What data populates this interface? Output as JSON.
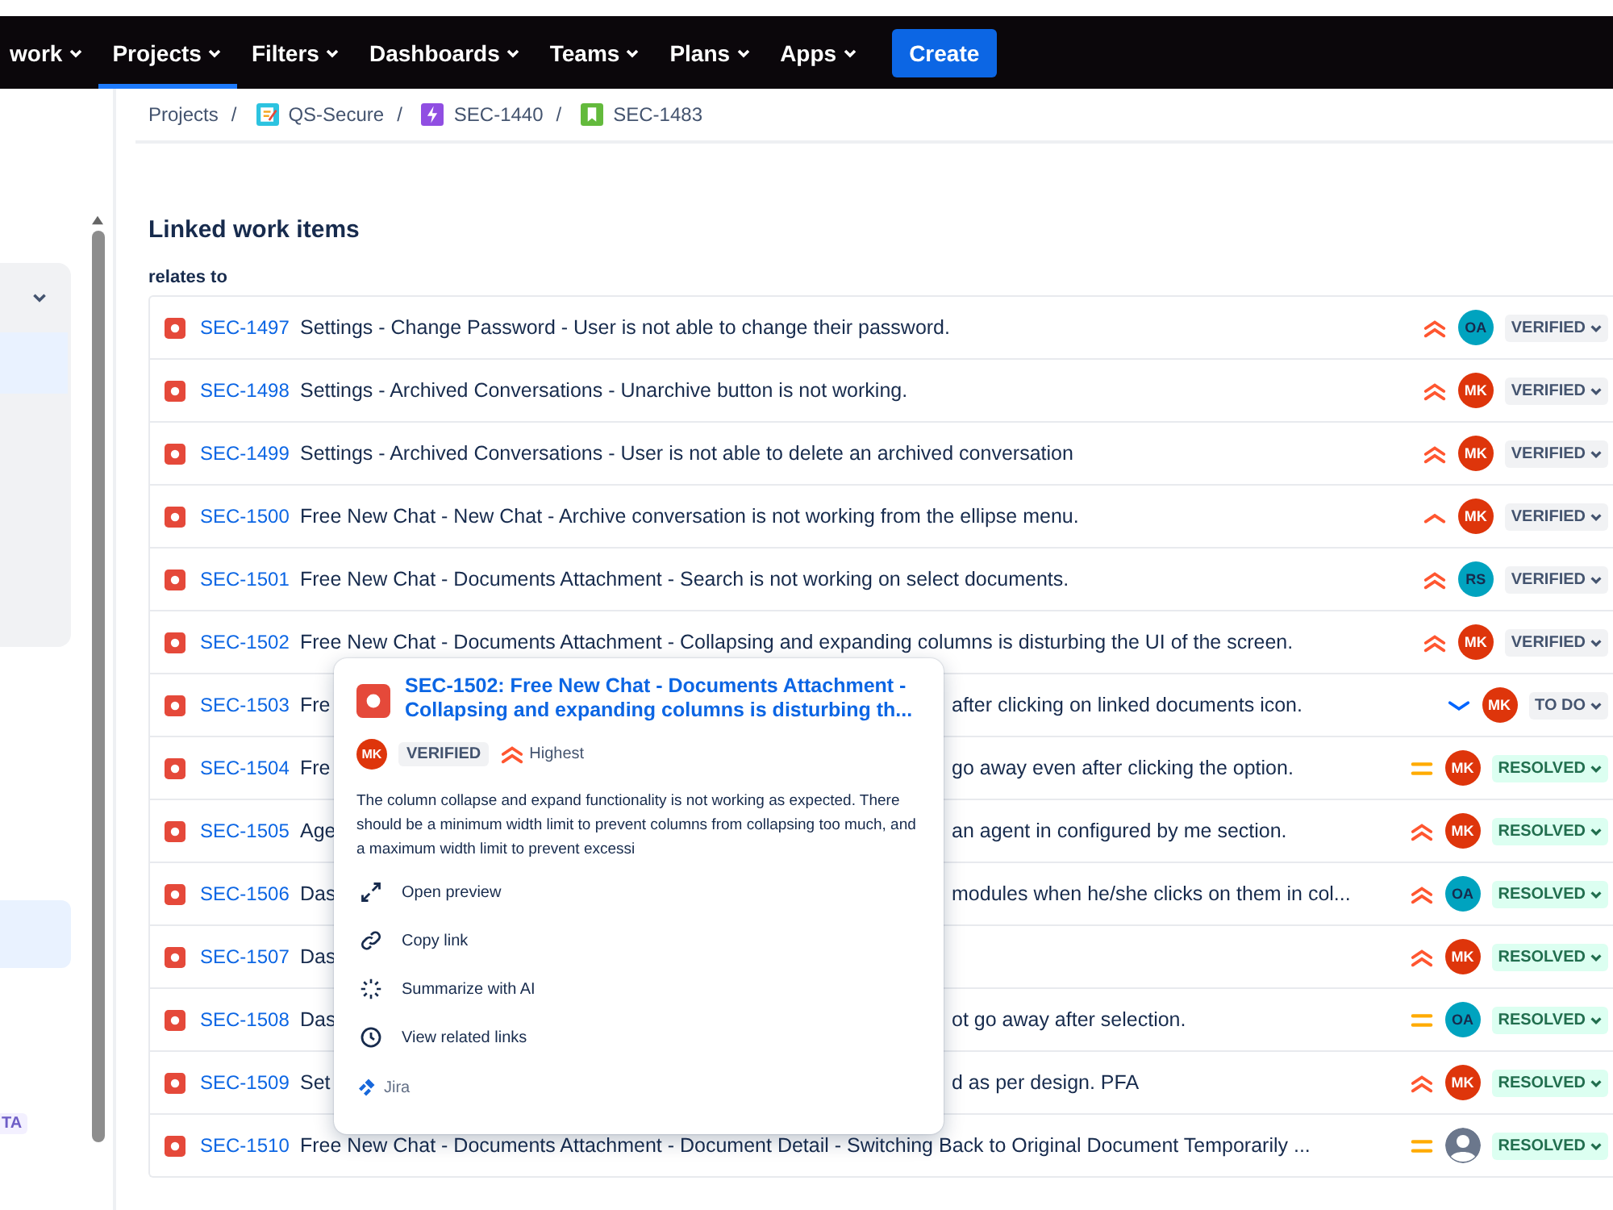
{
  "nav": {
    "items": [
      {
        "label": "work",
        "selected": false
      },
      {
        "label": "Projects",
        "selected": true
      },
      {
        "label": "Filters",
        "selected": false
      },
      {
        "label": "Dashboards",
        "selected": false
      },
      {
        "label": "Teams",
        "selected": false
      },
      {
        "label": "Plans",
        "selected": false
      },
      {
        "label": "Apps",
        "selected": false
      }
    ],
    "create": "Create"
  },
  "sidebar": {
    "badge": "TA"
  },
  "breadcrumbs": [
    {
      "label": "Projects",
      "kind": "text"
    },
    {
      "separator": "/",
      "label": "QS-Secure",
      "kind": "project"
    },
    {
      "separator": "/",
      "label": "SEC-1440",
      "kind": "epic"
    },
    {
      "separator": "/",
      "label": "SEC-1483",
      "kind": "story"
    }
  ],
  "section": {
    "title": "Linked work items",
    "relation": "relates to"
  },
  "rows": [
    {
      "key": "SEC-1497",
      "summary": "Settings - Change Password - User is not able to change their password.",
      "priority": {
        "kind": "highest"
      },
      "assignee": {
        "initials": "OA",
        "color": "#00a3bf"
      },
      "status": {
        "label": "VERIFIED",
        "kind": "verified"
      }
    },
    {
      "key": "SEC-1498",
      "summary": "Settings - Archived Conversations - Unarchive button is not working.",
      "priority": {
        "kind": "highest"
      },
      "assignee": {
        "initials": "MK",
        "color": "#de350b"
      },
      "status": {
        "label": "VERIFIED",
        "kind": "verified"
      }
    },
    {
      "key": "SEC-1499",
      "summary": "Settings - Archived Conversations - User is not able to delete an archived conversation",
      "priority": {
        "kind": "highest"
      },
      "assignee": {
        "initials": "MK",
        "color": "#de350b"
      },
      "status": {
        "label": "VERIFIED",
        "kind": "verified"
      }
    },
    {
      "key": "SEC-1500",
      "summary": "Free New Chat - New Chat - Archive conversation is not working from the ellipse menu.",
      "priority": {
        "kind": "high"
      },
      "assignee": {
        "initials": "MK",
        "color": "#de350b"
      },
      "status": {
        "label": "VERIFIED",
        "kind": "verified"
      }
    },
    {
      "key": "SEC-1501",
      "summary": "Free New Chat - Documents Attachment - Search is not working on select documents.",
      "priority": {
        "kind": "highest"
      },
      "assignee": {
        "initials": "RS",
        "color": "#00a3bf"
      },
      "status": {
        "label": "VERIFIED",
        "kind": "verified"
      }
    },
    {
      "key": "SEC-1502",
      "summary": "Free New Chat - Documents Attachment - Collapsing and expanding columns is disturbing the UI of the screen.",
      "priority": {
        "kind": "highest"
      },
      "assignee": {
        "initials": "MK",
        "color": "#de350b"
      },
      "status": {
        "label": "VERIFIED",
        "kind": "verified"
      }
    },
    {
      "key": "SEC-1503",
      "summary_start": "Fre",
      "summary_end": "after clicking on linked documents icon.",
      "priority": {
        "kind": "low"
      },
      "assignee": {
        "initials": "MK",
        "color": "#de350b"
      },
      "status": {
        "label": "TO DO",
        "kind": "todo"
      }
    },
    {
      "key": "SEC-1504",
      "summary_start": "Fre",
      "summary_end": "go away even after clicking the option.",
      "priority": {
        "kind": "medium"
      },
      "assignee": {
        "initials": "MK",
        "color": "#de350b"
      },
      "status": {
        "label": "RESOLVED",
        "kind": "resolved"
      }
    },
    {
      "key": "SEC-1505",
      "summary_start": "Age",
      "summary_end": "an agent in configured by me section.",
      "priority": {
        "kind": "highest"
      },
      "assignee": {
        "initials": "MK",
        "color": "#de350b"
      },
      "status": {
        "label": "RESOLVED",
        "kind": "resolved"
      }
    },
    {
      "key": "SEC-1506",
      "summary_start": "Das",
      "summary_end": "modules when he/she clicks on them in col...",
      "priority": {
        "kind": "highest"
      },
      "assignee": {
        "initials": "OA",
        "color": "#00a3bf"
      },
      "status": {
        "label": "RESOLVED",
        "kind": "resolved"
      }
    },
    {
      "key": "SEC-1507",
      "summary_start": "Das",
      "priority": {
        "kind": "highest"
      },
      "assignee": {
        "initials": "MK",
        "color": "#de350b"
      },
      "status": {
        "label": "RESOLVED",
        "kind": "resolved"
      }
    },
    {
      "key": "SEC-1508",
      "summary_start": "Das",
      "summary_end": "ot go away after selection.",
      "priority": {
        "kind": "medium"
      },
      "assignee": {
        "initials": "OA",
        "color": "#00a3bf"
      },
      "status": {
        "label": "RESOLVED",
        "kind": "resolved"
      }
    },
    {
      "key": "SEC-1509",
      "summary_start": "Set",
      "summary_end": "d as per design. PFA",
      "priority": {
        "kind": "highest"
      },
      "assignee": {
        "initials": "MK",
        "color": "#de350b"
      },
      "status": {
        "label": "RESOLVED",
        "kind": "resolved"
      }
    },
    {
      "key": "SEC-1510",
      "summary": "Free New Chat - Documents Attachment - Document Detail - Switching Back to Original Document Temporarily ...",
      "priority": {
        "kind": "medium"
      },
      "assignee": {
        "kind": "unassigned"
      },
      "status": {
        "label": "RESOLVED",
        "kind": "resolved"
      }
    }
  ],
  "popup": {
    "title": "SEC-1502: Free New Chat - Documents Attachment - Collapsing and expanding columns is disturbing th...",
    "assignee": {
      "initials": "MK",
      "color": "#de350b"
    },
    "status": {
      "label": "VERIFIED"
    },
    "priority": {
      "label": "Highest",
      "kind": "highest"
    },
    "description": "The column collapse and expand functionality is not working as expected. There should be a minimum width limit to prevent columns from collapsing too much, and a maximum width limit to prevent excessi",
    "actions": [
      {
        "label": "Open preview",
        "kind": "expand"
      },
      {
        "label": "Copy link",
        "kind": "link"
      },
      {
        "label": "Summarize with AI",
        "kind": "ai"
      },
      {
        "label": "View related links",
        "kind": "clock"
      }
    ],
    "footer": "Jira"
  }
}
